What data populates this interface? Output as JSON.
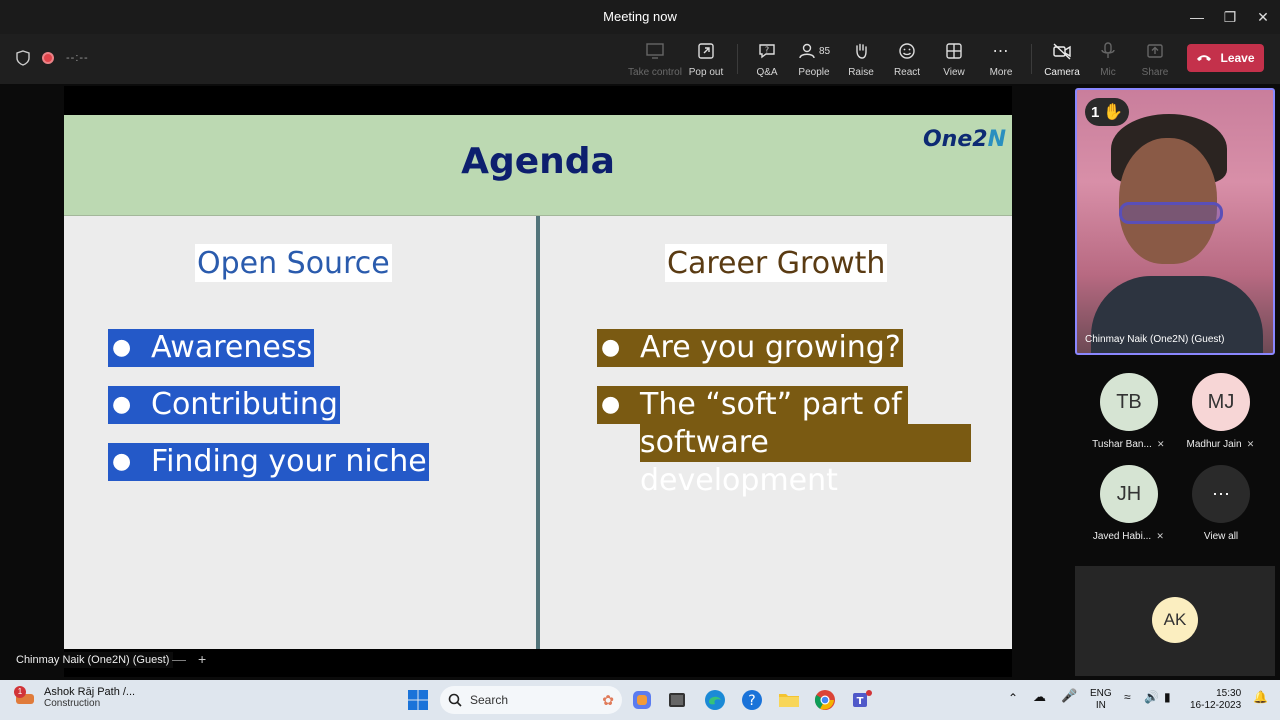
{
  "window": {
    "title": "Meeting now"
  },
  "toolbar": {
    "timer": "--:--",
    "take_control": "Take control",
    "pop_out": "Pop out",
    "qa": "Q&A",
    "people": "People",
    "people_count": "85",
    "raise": "Raise",
    "react": "React",
    "view": "View",
    "more": "More",
    "camera": "Camera",
    "mic": "Mic",
    "share": "Share",
    "leave": "Leave",
    "leave_color": "#c4314b"
  },
  "slide": {
    "title": "Agenda",
    "brand": "One2",
    "brand_suffix": "N",
    "left_heading": "Open Source",
    "left_items": [
      "Awareness",
      "Contributing",
      "Finding your niche"
    ],
    "right_heading": "Career Growth",
    "right_items": [
      "Are you growing?",
      "The “soft” part of",
      "software development"
    ],
    "colors": {
      "header_bg": "#bcd9b2",
      "left_highlight": "#2459c8",
      "right_highlight": "#7a5a12"
    }
  },
  "stage": {
    "speaker_label": "Chinmay Naik (One2N) (Guest)"
  },
  "participants": {
    "featured": {
      "name": "Chinmay Naik (One2N) (Guest)",
      "hand_count": "1"
    },
    "tiles": [
      {
        "initials": "TB",
        "name": "Tushar Ban...",
        "color": "#d8e6d8"
      },
      {
        "initials": "MJ",
        "name": "Madhur Jain",
        "color": "#f8d8d8"
      },
      {
        "initials": "JH",
        "name": "Javed Habi...",
        "color": "#d8e6d8"
      }
    ],
    "view_all": "View all",
    "overflow": {
      "initials": "AK"
    }
  },
  "taskbar": {
    "notification_count": "1",
    "weather_line1": "Ashok Rāj Path /...",
    "weather_line2": "Construction",
    "search": "Search",
    "lang_line1": "ENG",
    "lang_line2": "IN",
    "time": "15:30",
    "date": "16-12-2023"
  }
}
